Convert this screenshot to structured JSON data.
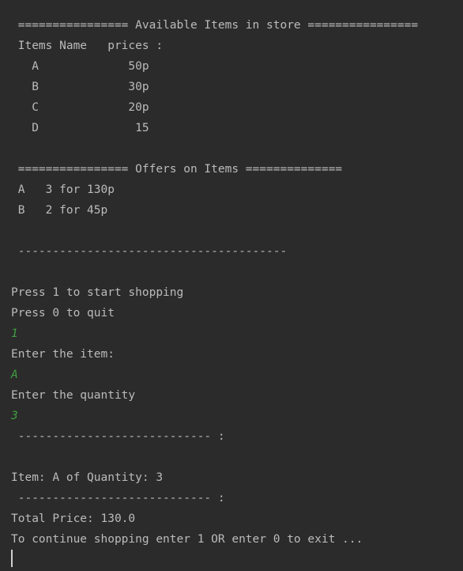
{
  "console": {
    "store_header": " ================ Available Items in store ================",
    "table_header": " Items Name   prices :",
    "items": [
      {
        "line": "   A             50p"
      },
      {
        "line": "   B             30p"
      },
      {
        "line": "   C             20p"
      },
      {
        "line": "   D              15"
      }
    ],
    "offers_header": " ================ Offers on Items ==============",
    "offers": [
      {
        "line": " A   3 for 130p"
      },
      {
        "line": " B   2 for 45p"
      }
    ],
    "separator": " ---------------------------------------",
    "press_start": "Press 1 to start shopping",
    "press_quit": "Press 0 to quit",
    "input_choice": "1",
    "prompt_item": "Enter the item:",
    "input_item": "A",
    "prompt_quantity": "Enter the quantity",
    "input_quantity": "3",
    "short_separator_1": " ---------------------------- :",
    "item_summary": "Item: A of Quantity: 3",
    "short_separator_2": " ---------------------------- :",
    "total_price": "Total Price: 130.0",
    "continue_prompt": "To continue shopping enter 1 OR enter 0 to exit ..."
  }
}
